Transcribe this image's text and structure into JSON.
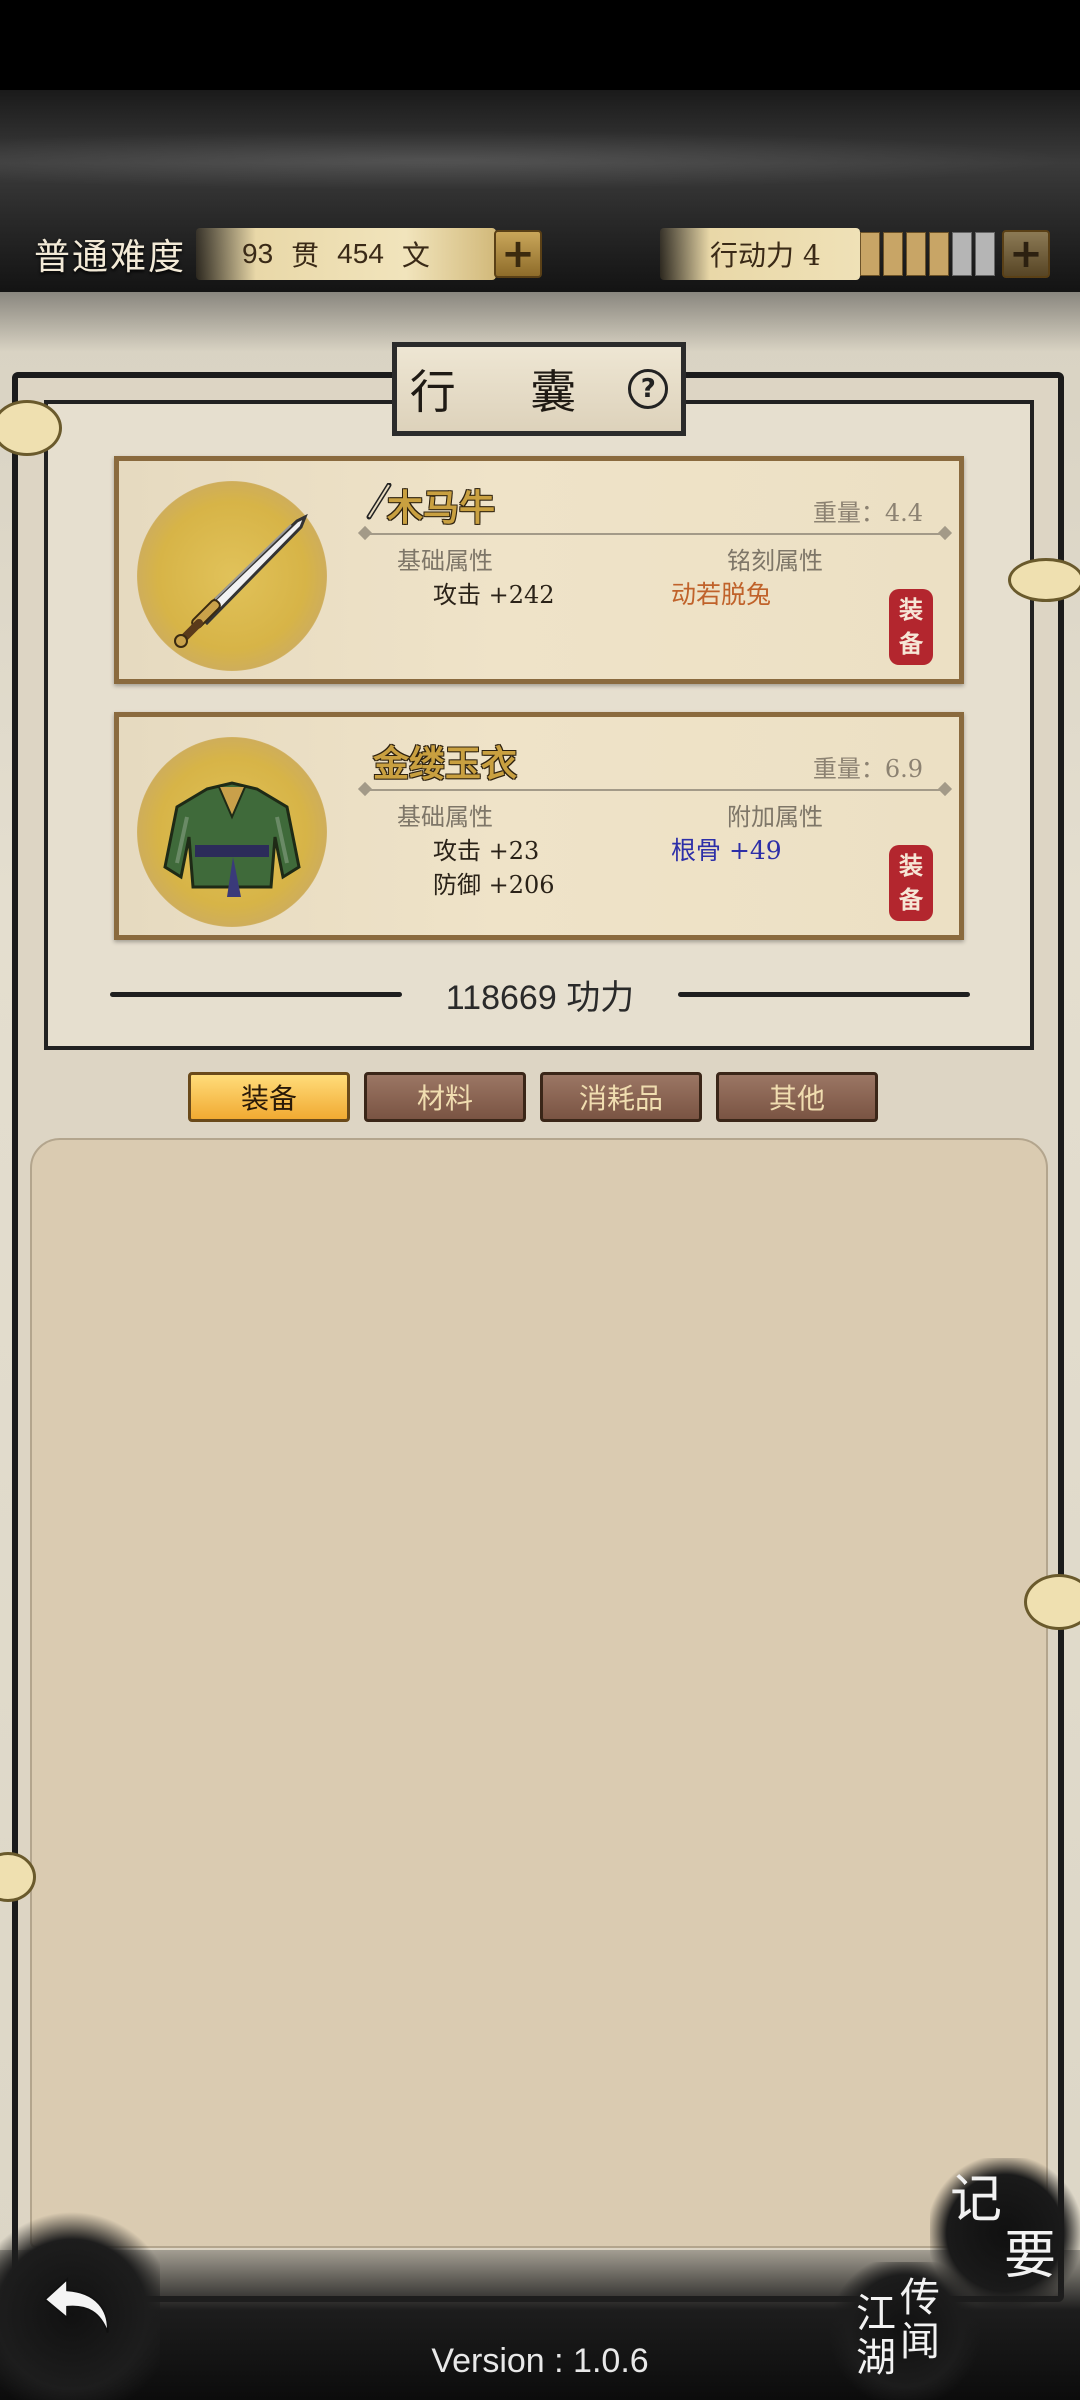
{
  "header": {
    "difficulty": "普通难度",
    "money": {
      "guan_amount": "93",
      "guan_unit": "贯",
      "wen_amount": "454",
      "wen_unit": "文"
    },
    "action_points": {
      "label": "行动力 4",
      "current": 4,
      "max": 6
    }
  },
  "panel": {
    "title": "行 囊"
  },
  "equipped": [
    {
      "name": "木马牛",
      "weight": "重量：4.4",
      "base_header": "基础属性",
      "extra_header": "铭刻属性",
      "base_stats": [
        "攻击 +242"
      ],
      "extra_stat": "动若脱兔",
      "seal": [
        "装",
        "备"
      ]
    },
    {
      "name": "金缕玉衣",
      "weight": "重量：6.9",
      "base_header": "基础属性",
      "extra_header": "附加属性",
      "base_stats": [
        "攻击 +23",
        "防御 +206"
      ],
      "extra_stat": "根骨 +49",
      "seal": [
        "装",
        "备"
      ]
    }
  ],
  "power": {
    "value": "118669",
    "unit": "功力"
  },
  "tabs": [
    "装备",
    "材料",
    "消耗品",
    "其他"
  ],
  "active_tab": "装备",
  "bottom": {
    "notes_button": [
      "记",
      "要"
    ],
    "rumor_button": {
      "col1": "传闻",
      "col2": "江湖"
    },
    "version": "Version : 1.0.6"
  },
  "colors": {
    "accent_gold": "#c9a040",
    "seal_red": "#b3262e",
    "inscription_orange": "#c0622a",
    "attribute_blue": "#2d2fa8",
    "tab_active": "#f1aa32",
    "tab_inactive": "#7a5443"
  },
  "icons": [
    "plus-icon",
    "help-icon",
    "sword-icon",
    "robe-icon",
    "brush-icon",
    "back-arrow-icon"
  ]
}
